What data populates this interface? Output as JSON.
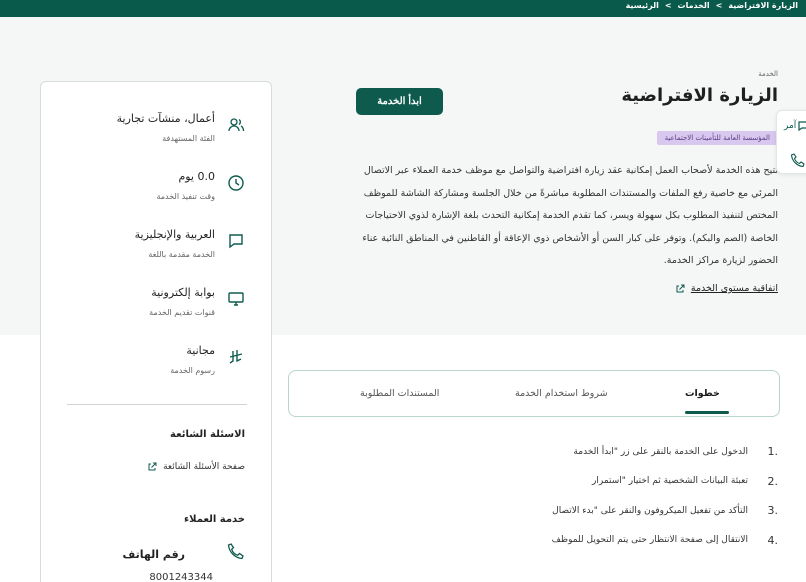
{
  "breadcrumb": [
    "الرئيسية",
    ">",
    "الخدمات",
    ">",
    "الزيارة الافتراضية"
  ],
  "service": {
    "label": "الخدمة",
    "title": "الزيارة الافتراضية",
    "start_button": "ابدأ الخدمة",
    "org_badge": "المؤسسة العامة للتأمينات الاجتماعية",
    "description": "تتيح هذه الخدمة لأصحاب العمل إمكانية عقد زيارة افتراضية والتواصل مع موظف خدمة العملاء عبر الاتصال المرئي مع خاصية رفع الملفات والمستندات المطلوبة مباشرةً من خلال الجلسة ومشاركة الشاشة للموظف المختص لتنفيذ المطلوب بكل سهولة ويسر، كما تقدم الخدمة إمكانية التحدث بلغة الإشارة لذوي الاحتياجات الخاصة (الصم والبكم). وتوفر على كبار السن أو الأشخاص ذوي الإعاقة أو القاطنين في المناطق النائية عناء الحضور لزيارة مراكز الخدمة.",
    "sla_link": "اتفاقية مستوى الخدمة"
  },
  "float_panel": {
    "amer_label": "آمر"
  },
  "info": [
    {
      "main": "أعمال، منشآت تجارية",
      "sub": "الفئة المستهدفة",
      "icon": "users-icon"
    },
    {
      "main": "0.0 يوم",
      "sub": "وقت تنفيذ الخدمة",
      "icon": "clock-icon"
    },
    {
      "main": "العربية والإنجليزية",
      "sub": "الخدمة مقدمة باللغة",
      "icon": "chat-icon"
    },
    {
      "main": "بوابة إلكترونية",
      "sub": "قنوات تقديم الخدمة",
      "icon": "monitor-icon"
    },
    {
      "main": "مجانية",
      "sub": "رسوم الخدمة",
      "icon": "riyal-icon"
    }
  ],
  "faq": {
    "title": "الاسئلة الشائعة",
    "link": "صفحة الأسئلة الشائعة"
  },
  "customer_service": {
    "title": "خدمة العملاء",
    "phone_label": "رقم الهاتف",
    "phone_number": "8001243344"
  },
  "tabs": [
    {
      "label": "خطوات",
      "active": true
    },
    {
      "label": "شروط استخدام الخدمة",
      "active": false
    },
    {
      "label": "المستندات المطلوبة",
      "active": false
    }
  ],
  "steps": [
    {
      "num": "1.",
      "text": "الدخول على الخدمة بالنقر على زر \"ابدأ الخدمة"
    },
    {
      "num": "2.",
      "text": "تعبئة البيانات الشخصية ثم اختيار \"استمرار"
    },
    {
      "num": "3.",
      "text": "التأكد من تفعيل الميكروفون والنقر على \"بدء الاتصال"
    },
    {
      "num": "4.",
      "text": "الانتقال إلى صفحة الانتظار حتى يتم التحويل للموظف"
    }
  ],
  "colors": {
    "primary": "#0e5b4e",
    "topbar": "#0a5a4b",
    "badge_bg": "#d8c7ee",
    "badge_text": "#5a3b83"
  }
}
